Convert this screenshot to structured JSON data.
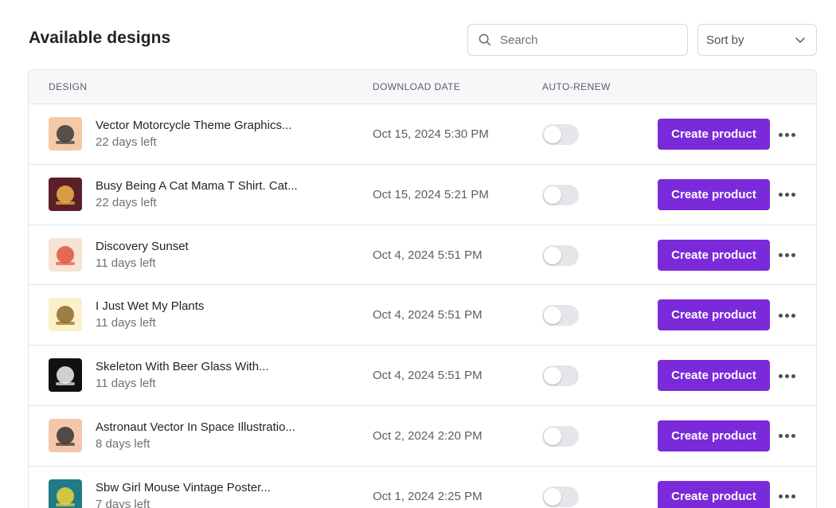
{
  "header": {
    "title": "Available designs",
    "search_placeholder": "Search",
    "sort_label": "Sort by"
  },
  "columns": {
    "design": "DESIGN",
    "download_date": "DOWNLOAD DATE",
    "auto_renew": "AUTO-RENEW"
  },
  "rows": [
    {
      "name": "Vector Motorcycle Theme Graphics...",
      "days_left": "22 days left",
      "download_date": "Oct 15, 2024 5:30 PM",
      "auto_renew": false,
      "action": "Create product",
      "thumb_bg": "#f3c9a8",
      "thumb_fg": "#3a3a3a"
    },
    {
      "name": "Busy Being A Cat Mama T Shirt. Cat...",
      "days_left": "22 days left",
      "download_date": "Oct 15, 2024 5:21 PM",
      "auto_renew": false,
      "action": "Create product",
      "thumb_bg": "#5b1f2a",
      "thumb_fg": "#f0b347"
    },
    {
      "name": "Discovery Sunset",
      "days_left": "11 days left",
      "download_date": "Oct 4, 2024 5:51 PM",
      "auto_renew": false,
      "action": "Create product",
      "thumb_bg": "#f6e3d3",
      "thumb_fg": "#e2553b"
    },
    {
      "name": "I Just Wet My Plants",
      "days_left": "11 days left",
      "download_date": "Oct 4, 2024 5:51 PM",
      "auto_renew": false,
      "action": "Create product",
      "thumb_bg": "#fbf0c8",
      "thumb_fg": "#8a6a2a"
    },
    {
      "name": "Skeleton With Beer Glass With...",
      "days_left": "11 days left",
      "download_date": "Oct 4, 2024 5:51 PM",
      "auto_renew": false,
      "action": "Create product",
      "thumb_bg": "#111111",
      "thumb_fg": "#f2f2f2"
    },
    {
      "name": "Astronaut Vector In Space Illustratio...",
      "days_left": "8 days left",
      "download_date": "Oct 2, 2024 2:20 PM",
      "auto_renew": false,
      "action": "Create product",
      "thumb_bg": "#f4c7ad",
      "thumb_fg": "#333333"
    },
    {
      "name": "Sbw Girl Mouse Vintage Poster...",
      "days_left": "7 days left",
      "download_date": "Oct 1, 2024 2:25 PM",
      "auto_renew": false,
      "action": "Create product",
      "thumb_bg": "#1f7c86",
      "thumb_fg": "#f2d23a"
    }
  ],
  "colors": {
    "accent": "#7b2ad9",
    "toggle_off": "#e4e6e9",
    "header_bg": "#f6f7f9",
    "border": "#e3e5e8"
  },
  "icons": {
    "search": "search-icon",
    "sort": "chevron-down-icon",
    "more": "more-horizontal-icon"
  }
}
